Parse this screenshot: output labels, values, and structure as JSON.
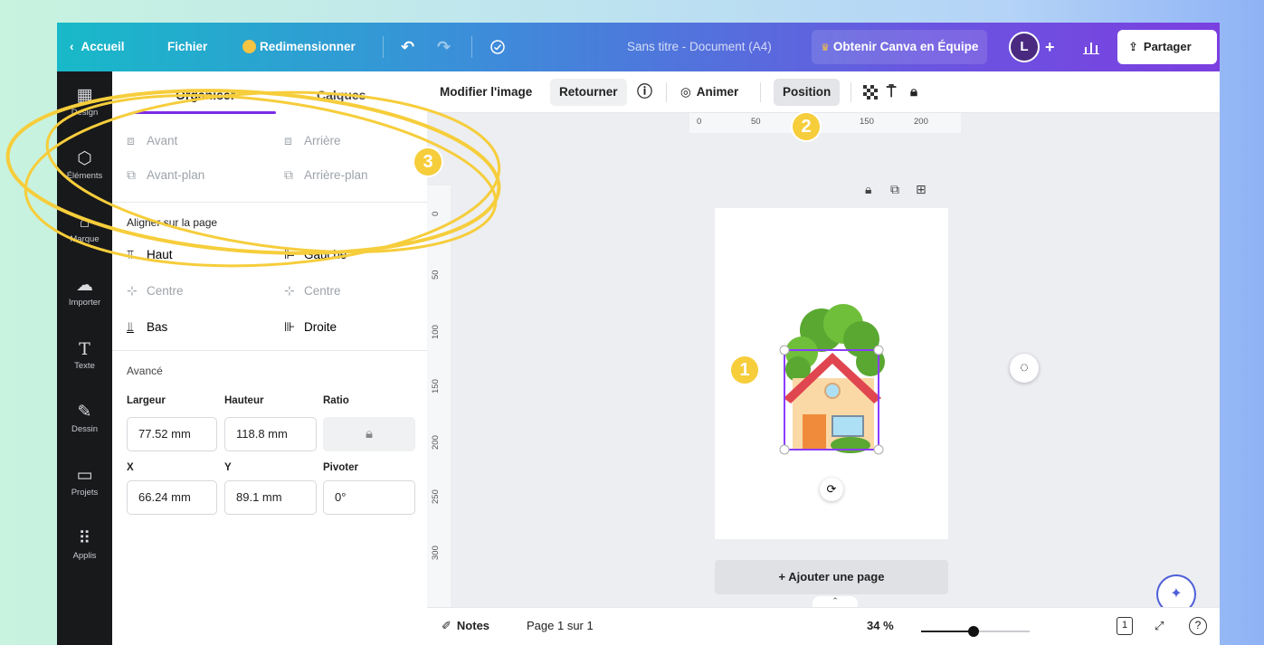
{
  "topbar": {
    "back_label": "Accueil",
    "file_label": "Fichier",
    "resize_label": "Redimensionner",
    "doc_title": "Sans titre - Document (A4)",
    "upgrade_label": "Obtenir Canva en Équipe",
    "avatar_initial": "L",
    "share_label": "Partager"
  },
  "rail": {
    "items": [
      {
        "label": "Design",
        "icon": "layout-icon"
      },
      {
        "label": "Éléments",
        "icon": "shapes-icon"
      },
      {
        "label": "Marque",
        "icon": "brand-icon"
      },
      {
        "label": "Importer",
        "icon": "upload-icon"
      },
      {
        "label": "Texte",
        "icon": "text-icon"
      },
      {
        "label": "Dessin",
        "icon": "draw-icon"
      },
      {
        "label": "Projets",
        "icon": "folder-icon"
      },
      {
        "label": "Applis",
        "icon": "grid-icon"
      }
    ]
  },
  "panel": {
    "tab_organize": "Organiser",
    "tab_layers": "Calques",
    "forward": "Avant",
    "backward": "Arrière",
    "to_front": "Avant-plan",
    "to_back": "Arrière-plan",
    "align_title": "Aligner sur la page",
    "align_top": "Haut",
    "align_left": "Gauche",
    "align_center_v": "Centre",
    "align_center_h": "Centre",
    "align_bottom": "Bas",
    "align_right": "Droite",
    "advanced_title": "Avancé",
    "width_label": "Largeur",
    "height_label": "Hauteur",
    "ratio_label": "Ratio",
    "width_value": "77.52 mm",
    "height_value": "118.8 mm",
    "x_label": "X",
    "y_label": "Y",
    "rotate_label": "Pivoter",
    "x_value": "66.24 mm",
    "y_value": "89.1 mm",
    "rotate_value": "0°"
  },
  "toolbar": {
    "edit_image": "Modifier l'image",
    "flip": "Retourner",
    "animate": "Animer",
    "position": "Position"
  },
  "ruler": {
    "top_ticks": [
      "0",
      "50",
      "100",
      "150",
      "200"
    ],
    "left_ticks": [
      "0",
      "50",
      "100",
      "150",
      "200",
      "250",
      "300"
    ]
  },
  "canvas": {
    "add_page": "+ Ajouter une page"
  },
  "bottombar": {
    "notes": "Notes",
    "page_indicator": "Page 1 sur 1",
    "zoom": "34 %",
    "page_count": "1",
    "zoom_fraction": 0.48
  },
  "badges": [
    "1",
    "2",
    "3"
  ],
  "colors": {
    "accent": "#7d2ae8",
    "badge": "#f6cd3b",
    "rail": "#18191b"
  }
}
